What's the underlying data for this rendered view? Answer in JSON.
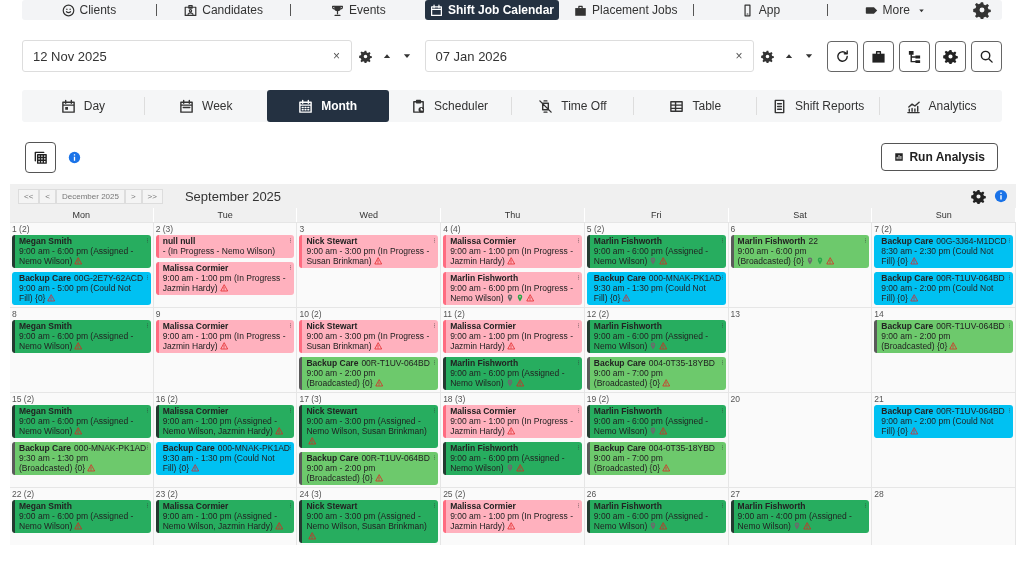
{
  "top_nav": {
    "items": [
      {
        "label": "Clients",
        "selected": false,
        "dropdown": false
      },
      {
        "label": "Candidates",
        "selected": false,
        "dropdown": false
      },
      {
        "label": "Events",
        "selected": false,
        "dropdown": false
      },
      {
        "label": "Shift Job Calendar",
        "selected": true,
        "dropdown": false
      },
      {
        "label": "Placement Jobs",
        "selected": false,
        "dropdown": false
      },
      {
        "label": "App",
        "selected": false,
        "dropdown": false
      },
      {
        "label": "More",
        "selected": false,
        "dropdown": true
      }
    ]
  },
  "date_range": {
    "start": {
      "value": "12 Nov 2025",
      "clear": "×"
    },
    "end": {
      "value": "07 Jan 2026",
      "clear": "×"
    }
  },
  "view_tabs": [
    {
      "label": "Day",
      "selected": false
    },
    {
      "label": "Week",
      "selected": false
    },
    {
      "label": "Month",
      "selected": true
    },
    {
      "label": "Scheduler",
      "selected": false
    },
    {
      "label": "Time Off",
      "selected": false
    },
    {
      "label": "Table",
      "selected": false
    },
    {
      "label": "Shift Reports",
      "selected": false
    },
    {
      "label": "Analytics",
      "selected": false
    }
  ],
  "run_analysis": {
    "label": "Run Analysis"
  },
  "calendar": {
    "nav": [
      "<<",
      "<",
      "December 2025",
      ">",
      ">>"
    ],
    "title": "September 2025",
    "weekdays": [
      "Mon",
      "Tue",
      "Wed",
      "Thu",
      "Fri",
      "Sat",
      "Sun"
    ],
    "weeks": [
      [
        {
          "date": "1 (2)",
          "events": [
            {
              "name": "Megan Smith",
              "kind": "assigned",
              "details": "9:00 am - 6:00 pm (Assigned - Nemo Wilson)",
              "pin": false,
              "green_pin": false,
              "warning": true
            },
            {
              "name": "Backup Care",
              "code": "00G-2E7Y-62ACD",
              "kind": "unfilled",
              "details": "9:00 am - 5:00 pm (Could Not Fill) {0}",
              "pin": false,
              "green_pin": false,
              "warning": true
            }
          ]
        },
        {
          "date": "2 (3)",
          "events": [
            {
              "name": "null null",
              "kind": "progress",
              "details": "- (In Progress - Nemo Wilson)",
              "pin": false,
              "green_pin": false,
              "warning": false
            },
            {
              "name": "Malissa Cormier",
              "kind": "progress",
              "details": "9:00 am - 1:00 pm (In Progress - Jazmin Hardy)",
              "pin": false,
              "green_pin": false,
              "warning": true
            }
          ]
        },
        {
          "date": "3",
          "events": [
            {
              "name": "Nick Stewart",
              "kind": "progress",
              "details": "9:00 am - 3:00 pm (In Progress - Susan Brinkman)",
              "pin": false,
              "green_pin": false,
              "warning": true
            }
          ]
        },
        {
          "date": "4 (4)",
          "events": [
            {
              "name": "Malissa Cormier",
              "kind": "progress",
              "details": "9:00 am - 1:00 pm (In Progress - Jazmin Hardy)",
              "pin": false,
              "green_pin": false,
              "warning": true
            },
            {
              "name": "Marlin Fishworth",
              "kind": "progress",
              "details": "9:00 am - 6:00 pm (In Progress - Nemo Wilson)",
              "pin": true,
              "green_pin": true,
              "warning": true
            }
          ]
        },
        {
          "date": "5 (2)",
          "events": [
            {
              "name": "Marlin Fishworth",
              "kind": "assigned",
              "details": "9:00 am - 6:00 pm (Assigned - Nemo Wilson)",
              "pin": true,
              "green_pin": false,
              "warning": true
            },
            {
              "name": "Backup Care",
              "code": "000-MNAK-PK1AD",
              "kind": "unfilled",
              "details": "9:30 am - 1:30 pm (Could Not Fill) {0}",
              "pin": false,
              "green_pin": false,
              "warning": true
            }
          ]
        },
        {
          "date": "6",
          "events": [
            {
              "name": "Marlin Fishworth",
              "code": "22",
              "kind": "broadcast",
              "details": "9:00 am - 6:00 pm (Broadcasted) {0}",
              "pin": true,
              "green_pin": true,
              "warning": true
            }
          ]
        },
        {
          "date": "7 (2)",
          "events": [
            {
              "name": "Backup Care",
              "code": "00G-3J64-M1DCD",
              "kind": "unfilled",
              "details": "8:30 am - 2:30 pm (Could Not Fill) {0}",
              "pin": false,
              "green_pin": false,
              "warning": true
            },
            {
              "name": "Backup Care",
              "code": "00R-T1UV-064BD",
              "kind": "unfilled",
              "details": "9:00 am - 2:00 pm (Could Not Fill) {0}",
              "pin": false,
              "green_pin": false,
              "warning": true
            }
          ]
        }
      ],
      [
        {
          "date": "8",
          "events": [
            {
              "name": "Megan Smith",
              "kind": "assigned",
              "details": "9:00 am - 6:00 pm (Assigned - Nemo Wilson)",
              "pin": false,
              "green_pin": false,
              "warning": true
            }
          ]
        },
        {
          "date": "9",
          "events": [
            {
              "name": "Malissa Cormier",
              "kind": "progress",
              "details": "9:00 am - 1:00 pm (In Progress - Jazmin Hardy)",
              "pin": false,
              "green_pin": false,
              "warning": true
            }
          ]
        },
        {
          "date": "10 (2)",
          "events": [
            {
              "name": "Nick Stewart",
              "kind": "progress",
              "details": "9:00 am - 3:00 pm (In Progress - Susan Brinkman)",
              "pin": false,
              "green_pin": false,
              "warning": true
            },
            {
              "name": "Backup Care",
              "code": "00R-T1UV-064BD",
              "kind": "broadcast",
              "details": "9:00 am - 2:00 pm (Broadcasted) {0}",
              "pin": false,
              "green_pin": false,
              "warning": true
            }
          ]
        },
        {
          "date": "11 (2)",
          "events": [
            {
              "name": "Malissa Cormier",
              "kind": "progress",
              "details": "9:00 am - 1:00 pm (In Progress - Jazmin Hardy)",
              "pin": false,
              "green_pin": false,
              "warning": true
            },
            {
              "name": "Marlin Fishworth",
              "kind": "assigned",
              "details": "9:00 am - 6:00 pm (Assigned - Nemo Wilson)",
              "pin": true,
              "green_pin": false,
              "warning": true
            }
          ]
        },
        {
          "date": "12 (2)",
          "events": [
            {
              "name": "Marlin Fishworth",
              "kind": "assigned",
              "details": "9:00 am - 6:00 pm (Assigned - Nemo Wilson)",
              "pin": true,
              "green_pin": false,
              "warning": true
            },
            {
              "name": "Backup Care",
              "code": "004-0T35-18YBD",
              "kind": "broadcast",
              "details": "9:00 am - 7:00 pm (Broadcasted) {0}",
              "pin": false,
              "green_pin": false,
              "warning": true
            }
          ]
        },
        {
          "date": "13"
        },
        {
          "date": "14",
          "events": [
            {
              "name": "Backup Care",
              "code": "00R-T1UV-064BD",
              "kind": "broadcast",
              "details": "9:00 am - 2:00 pm (Broadcasted) {0}",
              "pin": false,
              "green_pin": false,
              "warning": true
            }
          ]
        }
      ],
      [
        {
          "date": "15 (2)",
          "events": [
            {
              "name": "Megan Smith",
              "kind": "assigned",
              "details": "9:00 am - 6:00 pm (Assigned - Nemo Wilson)",
              "pin": false,
              "green_pin": false,
              "warning": true
            },
            {
              "name": "Backup Care",
              "code": "000-MNAK-PK1AD",
              "kind": "broadcast",
              "details": "9:30 am - 1:30 pm (Broadcasted) {0}",
              "pin": false,
              "green_pin": false,
              "warning": true
            }
          ]
        },
        {
          "date": "16 (2)",
          "events": [
            {
              "name": "Malissa Cormier",
              "kind": "assigned",
              "details": "9:00 am - 1:00 pm (Assigned - Nemo Wilson, Jazmin Hardy)",
              "pin": false,
              "green_pin": false,
              "warning": true
            },
            {
              "name": "Backup Care",
              "code": "000-MNAK-PK1AD",
              "kind": "unfilled",
              "details": "9:30 am - 1:30 pm (Could Not Fill) {0}",
              "pin": false,
              "green_pin": false,
              "warning": true
            }
          ]
        },
        {
          "date": "17 (3)",
          "events": [
            {
              "name": "Nick Stewart",
              "kind": "assigned",
              "details": "9:00 am - 3:00 pm (Assigned - Nemo Wilson, Susan Brinkman)",
              "pin": false,
              "green_pin": false,
              "warning": true
            },
            {
              "name": "Backup Care",
              "code": "00R-T1UV-064BD",
              "kind": "broadcast",
              "details": "9:00 am - 2:00 pm (Broadcasted) {0}",
              "pin": false,
              "green_pin": false,
              "warning": true
            }
          ]
        },
        {
          "date": "18 (3)",
          "events": [
            {
              "name": "Malissa Cormier",
              "kind": "progress",
              "details": "9:00 am - 1:00 pm (In Progress - Jazmin Hardy)",
              "pin": false,
              "green_pin": false,
              "warning": true
            },
            {
              "name": "Marlin Fishworth",
              "kind": "assigned",
              "details": "9:00 am - 6:00 pm (Assigned - Nemo Wilson)",
              "pin": true,
              "green_pin": false,
              "warning": true
            }
          ]
        },
        {
          "date": "19 (2)",
          "events": [
            {
              "name": "Marlin Fishworth",
              "kind": "assigned",
              "details": "9:00 am - 6:00 pm (Assigned - Nemo Wilson)",
              "pin": true,
              "green_pin": false,
              "warning": true
            },
            {
              "name": "Backup Care",
              "code": "004-0T35-18YBD",
              "kind": "broadcast",
              "details": "9:00 am - 7:00 pm (Broadcasted) {0}",
              "pin": false,
              "green_pin": false,
              "warning": true
            }
          ]
        },
        {
          "date": "20"
        },
        {
          "date": "21",
          "events": [
            {
              "name": "Backup Care",
              "code": "00R-T1UV-064BD",
              "kind": "unfilled",
              "details": "9:00 am - 2:00 pm (Could Not Fill) {0}",
              "pin": false,
              "green_pin": false,
              "warning": true
            }
          ]
        }
      ],
      [
        {
          "date": "22 (2)",
          "events": [
            {
              "name": "Megan Smith",
              "kind": "assigned",
              "details": "9:00 am - 6:00 pm (Assigned - Nemo Wilson)",
              "pin": false,
              "green_pin": false,
              "warning": true
            }
          ]
        },
        {
          "date": "23 (2)",
          "events": [
            {
              "name": "Malissa Cormier",
              "kind": "assigned",
              "details": "9:00 am - 1:00 pm (Assigned - Nemo Wilson, Jazmin Hardy)",
              "pin": false,
              "green_pin": false,
              "warning": true
            }
          ]
        },
        {
          "date": "24 (3)",
          "events": [
            {
              "name": "Nick Stewart",
              "kind": "assigned",
              "details": "9:00 am - 3:00 pm (Assigned - Nemo Wilson, Susan Brinkman)",
              "pin": false,
              "green_pin": false,
              "warning": true
            }
          ]
        },
        {
          "date": "25 (2)",
          "events": [
            {
              "name": "Malissa Cormier",
              "kind": "progress",
              "details": "9:00 am - 1:00 pm (In Progress - Jazmin Hardy)",
              "pin": false,
              "green_pin": false,
              "warning": true
            }
          ]
        },
        {
          "date": "26",
          "events": [
            {
              "name": "Marlin Fishworth",
              "kind": "assigned",
              "details": "9:00 am - 6:00 pm (Assigned - Nemo Wilson)",
              "pin": true,
              "green_pin": false,
              "warning": true
            }
          ]
        },
        {
          "date": "27",
          "events": [
            {
              "name": "Marlin Fishworth",
              "kind": "assigned",
              "details": "9:00 am - 4:00 pm (Assigned - Nemo Wilson)",
              "pin": true,
              "green_pin": false,
              "warning": true
            }
          ]
        },
        {
          "date": "28"
        }
      ]
    ]
  }
}
